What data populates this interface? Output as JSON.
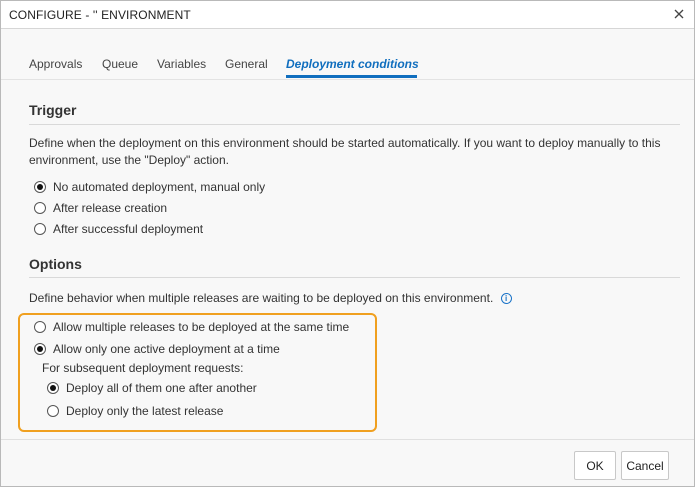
{
  "title": "CONFIGURE - '' ENVIRONMENT",
  "tabs": [
    {
      "label": "Approvals"
    },
    {
      "label": "Queue"
    },
    {
      "label": "Variables"
    },
    {
      "label": "General"
    },
    {
      "label": "Deployment conditions",
      "active": true
    }
  ],
  "trigger": {
    "heading": "Trigger",
    "description": "Define when the deployment on this environment should be started automatically. If you want to deploy manually to this environment, use the \"Deploy\" action.",
    "options": [
      {
        "label": "No automated deployment, manual only",
        "checked": true
      },
      {
        "label": "After release creation",
        "checked": false
      },
      {
        "label": "After successful deployment",
        "checked": false
      }
    ]
  },
  "options": {
    "heading": "Options",
    "description": "Define behavior when multiple releases are waiting to be deployed on this environment.",
    "choices": [
      {
        "label": "Allow multiple releases to be deployed at the same time",
        "checked": false
      },
      {
        "label": "Allow only one active deployment at a time",
        "checked": true
      }
    ],
    "sub_label": "For subsequent deployment requests:",
    "sub_choices": [
      {
        "label": "Deploy all of them one after another",
        "checked": true
      },
      {
        "label": "Deploy only the latest release",
        "checked": false
      }
    ]
  },
  "footer": {
    "ok_label": "OK",
    "cancel_label": "Cancel"
  },
  "colors": {
    "accent": "#106ebe",
    "highlight": "#f0a020"
  },
  "icons": {
    "close": "close-icon",
    "info": "info-icon"
  }
}
